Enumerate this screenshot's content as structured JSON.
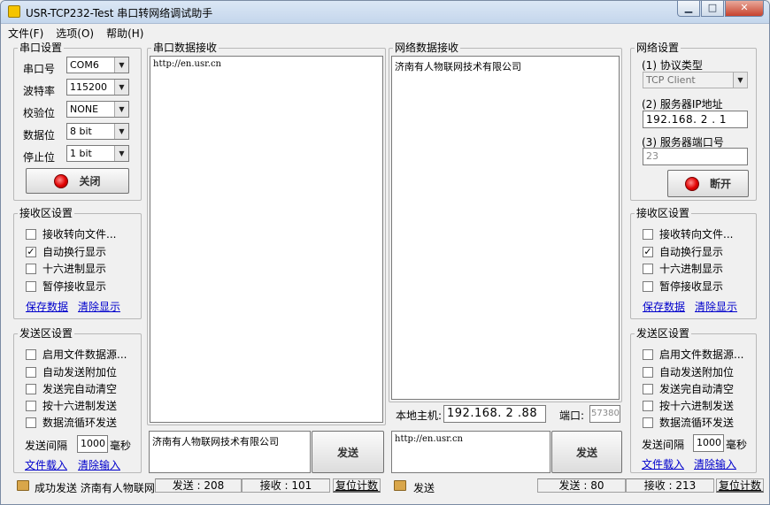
{
  "window": {
    "title": "USR-TCP232-Test 串口转网络调试助手",
    "controls": {
      "minimize": "▁",
      "maximize": "□",
      "close": "✕"
    }
  },
  "menu": [
    "文件(F)",
    "选项(O)",
    "帮助(H)"
  ],
  "serial": {
    "group_title": "串口设置",
    "port_label": "串口号",
    "port_value": "COM6",
    "baud_label": "波特率",
    "baud_value": "115200",
    "parity_label": "校验位",
    "parity_value": "NONE",
    "databits_label": "数据位",
    "databits_value": "8 bit",
    "stopbits_label": "停止位",
    "stopbits_value": "1 bit",
    "toggle_button": "关闭"
  },
  "serial_receive_settings": {
    "group_title": "接收区设置",
    "options": [
      {
        "label": "接收转向文件...",
        "checked": false
      },
      {
        "label": "自动换行显示",
        "checked": true
      },
      {
        "label": "十六进制显示",
        "checked": false
      },
      {
        "label": "暂停接收显示",
        "checked": false
      }
    ],
    "save_link": "保存数据",
    "clear_link": "清除显示"
  },
  "serial_send_settings": {
    "group_title": "发送区设置",
    "options": [
      {
        "label": "启用文件数据源...",
        "checked": false
      },
      {
        "label": "自动发送附加位",
        "checked": false
      },
      {
        "label": "发送完自动清空",
        "checked": false
      },
      {
        "label": "按十六进制发送",
        "checked": false
      },
      {
        "label": "数据流循环发送",
        "checked": false
      }
    ],
    "interval_label": "发送间隔",
    "interval_value": "1000",
    "interval_unit": "毫秒",
    "load_link": "文件载入",
    "clear_link": "清除输入"
  },
  "serial_rx": {
    "group_title": "串口数据接收",
    "content": "http://en.usr.cn"
  },
  "serial_tx": {
    "content": "济南有人物联网技术有限公司",
    "send_button": "发送"
  },
  "net_rx": {
    "group_title": "网络数据接收",
    "content": "济南有人物联网技术有限公司"
  },
  "net_local": {
    "host_label": "本地主机:",
    "host_value": "192.168. 2 .88",
    "port_label": "端口:",
    "port_value": "57380"
  },
  "net_tx": {
    "content": "http://en.usr.cn",
    "send_button": "发送"
  },
  "network": {
    "group_title": "网络设置",
    "protocol_label": "(1) 协议类型",
    "protocol_value": "TCP Client",
    "server_ip_label": "(2) 服务器IP地址",
    "server_ip_value": "192.168. 2 . 1",
    "server_port_label": "(3) 服务器端口号",
    "server_port_value": "23",
    "toggle_button": "断开"
  },
  "net_receive_settings": {
    "group_title": "接收区设置",
    "options": [
      {
        "label": "接收转向文件...",
        "checked": false
      },
      {
        "label": "自动换行显示",
        "checked": true
      },
      {
        "label": "十六进制显示",
        "checked": false
      },
      {
        "label": "暂停接收显示",
        "checked": false
      }
    ],
    "save_link": "保存数据",
    "clear_link": "清除显示"
  },
  "net_send_settings": {
    "group_title": "发送区设置",
    "options": [
      {
        "label": "启用文件数据源...",
        "checked": false
      },
      {
        "label": "自动发送附加位",
        "checked": false
      },
      {
        "label": "发送完自动清空",
        "checked": false
      },
      {
        "label": "按十六进制发送",
        "checked": false
      },
      {
        "label": "数据流循环发送",
        "checked": false
      }
    ],
    "interval_label": "发送间隔",
    "interval_value": "1000",
    "interval_unit": "毫秒",
    "load_link": "文件载入",
    "clear_link": "清除输入"
  },
  "status": {
    "serial_message": "成功发送 济南有人物联网",
    "serial_sent": "发送 : 208",
    "serial_received": "接收 : 101",
    "serial_reset": "复位计数",
    "net_message": "发送",
    "net_sent": "发送 : 80",
    "net_received": "接收 : 213",
    "net_reset": "复位计数"
  },
  "colors": {
    "link": "#0000cc",
    "led": "#e00000",
    "titlebar": "#c4d6ec"
  }
}
